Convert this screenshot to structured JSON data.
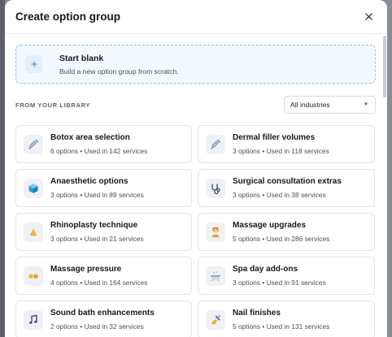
{
  "dialog": {
    "title": "Create option group",
    "close_icon": "close-icon"
  },
  "start_blank": {
    "icon": "plus-icon",
    "title": "Start blank",
    "subtitle": "Build a new option group from scratch."
  },
  "library": {
    "label": "FROM YOUR LIBRARY",
    "industry_select": {
      "value": "All industries",
      "icon": "chevron-down-icon"
    }
  },
  "cards": [
    {
      "title": "Botox area selection",
      "meta": "6 options • Used in 142 services",
      "icon": "syringe-icon"
    },
    {
      "title": "Dermal filler volumes",
      "meta": "3 options • Used in 118 services",
      "icon": "syringe-icon"
    },
    {
      "title": "Anaesthetic options",
      "meta": "3 options • Used in 89 services",
      "icon": "cube-icon"
    },
    {
      "title": "Surgical consultation extras",
      "meta": "3 options • Used in 38 services",
      "icon": "stethoscope-icon"
    },
    {
      "title": "Rhinoplasty technique",
      "meta": "3 options • Used in 21 services",
      "icon": "nose-icon"
    },
    {
      "title": "Massage upgrades",
      "meta": "5 options • Used in 286 services",
      "icon": "person-massage-icon"
    },
    {
      "title": "Massage pressure",
      "meta": "4 options • Used in 164 services",
      "icon": "hands-icon"
    },
    {
      "title": "Spa day add-ons",
      "meta": "3 options • Used in 91 services",
      "icon": "bathtub-icon"
    },
    {
      "title": "Sound bath enhancements",
      "meta": "2 options • Used in 32 services",
      "icon": "music-note-icon"
    },
    {
      "title": "Nail finishes",
      "meta": "5 options • Used in 131 services",
      "icon": "nail-polish-icon"
    }
  ],
  "colors": {
    "accent": "#2f8ad6",
    "start_blank_bg": "#f3f9fe",
    "start_blank_border": "#8fc3e8"
  }
}
